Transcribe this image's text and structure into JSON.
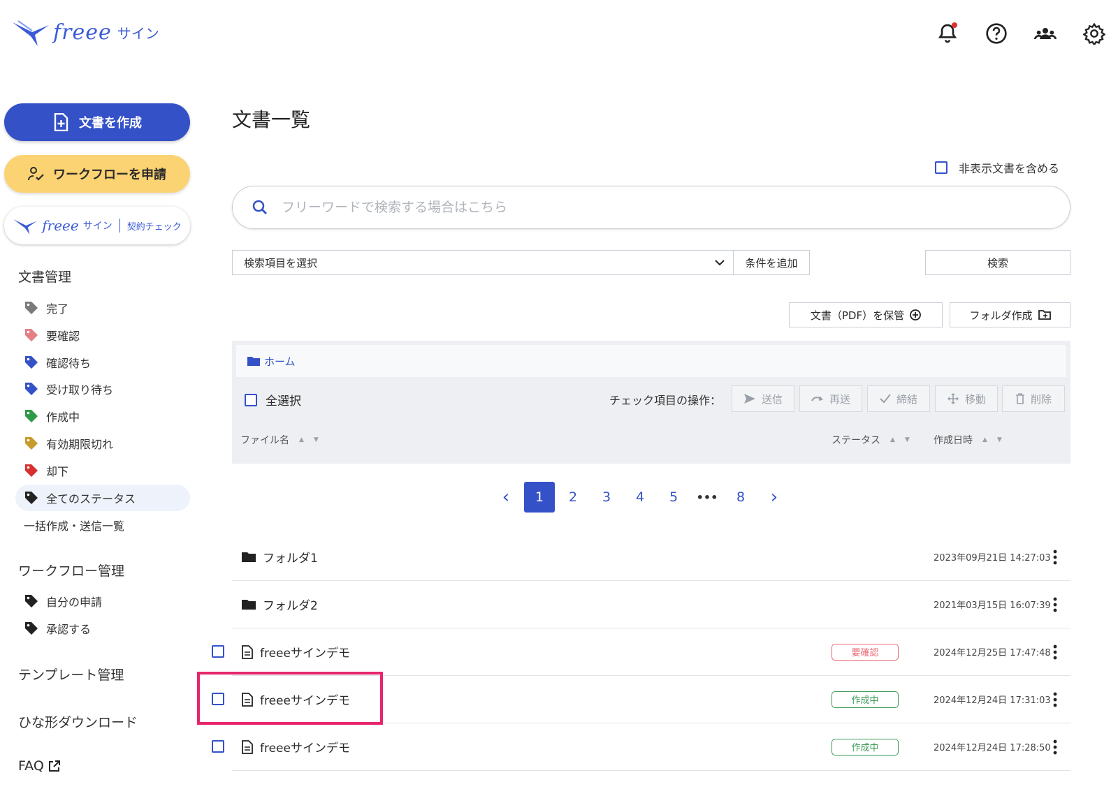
{
  "header": {
    "logo_text": "freee",
    "logo_sub": "サイン"
  },
  "sidebar": {
    "create_doc": "文書を作成",
    "apply_workflow": "ワークフローを申請",
    "contract_check": {
      "brand": "freee",
      "service": "サイン",
      "feature": "契約チェック"
    },
    "doc_mgmt_heading": "文書管理",
    "doc_statuses": [
      {
        "label": "完了",
        "color": "#7a7a7a"
      },
      {
        "label": "要確認",
        "color": "#e57f86"
      },
      {
        "label": "確認待ち",
        "color": "#3451c7"
      },
      {
        "label": "受け取り待ち",
        "color": "#3451c7"
      },
      {
        "label": "作成中",
        "color": "#2e9a48"
      },
      {
        "label": "有効期限切れ",
        "color": "#c79a2b"
      },
      {
        "label": "却下",
        "color": "#d73030"
      },
      {
        "label": "全てのステータス",
        "color": "#222222"
      }
    ],
    "bulk_list": "一括作成・送信一覧",
    "workflow_heading": "ワークフロー管理",
    "workflow_items": [
      {
        "label": "自分の申請",
        "color": "#222222"
      },
      {
        "label": "承認する",
        "color": "#222222"
      }
    ],
    "template_heading": "テンプレート管理",
    "download_heading": "ひな形ダウンロード",
    "faq": "FAQ"
  },
  "main": {
    "title": "文書一覧",
    "include_hidden": "非表示文書を含める",
    "search_placeholder": "フリーワードで検索する場合はこちら",
    "select_placeholder": "検索項目を選択",
    "add_condition": "条件を追加",
    "search": "検索",
    "store_pdf": "文書（PDF）を保管",
    "create_folder": "フォルダ作成",
    "breadcrumb_home": "ホーム",
    "select_all": "全選択",
    "ops_label": "チェック項目の操作：",
    "ops": {
      "send": "送信",
      "resend": "再送",
      "conclude": "締結",
      "move": "移動",
      "delete": "削除"
    },
    "columns": {
      "file_name": "ファイル名",
      "status": "ステータス",
      "created": "作成日時"
    },
    "pagination": [
      "1",
      "2",
      "3",
      "4",
      "5",
      "•••",
      "8"
    ],
    "rows": [
      {
        "type": "folder",
        "name": "フォルダ1",
        "status": "",
        "date": "2023年09月21日 14:27:03"
      },
      {
        "type": "folder",
        "name": "フォルダ2",
        "status": "",
        "date": "2021年03月15日 16:07:39"
      },
      {
        "type": "file",
        "name": "freeeサインデモ",
        "status": "要確認",
        "date": "2024年12月25日 17:47:48"
      },
      {
        "type": "file",
        "name": "freeeサインデモ",
        "status": "作成中",
        "date": "2024年12月24日 17:31:03"
      },
      {
        "type": "file",
        "name": "freeeサインデモ",
        "status": "作成中",
        "date": "2024年12月24日 17:28:50"
      }
    ]
  }
}
